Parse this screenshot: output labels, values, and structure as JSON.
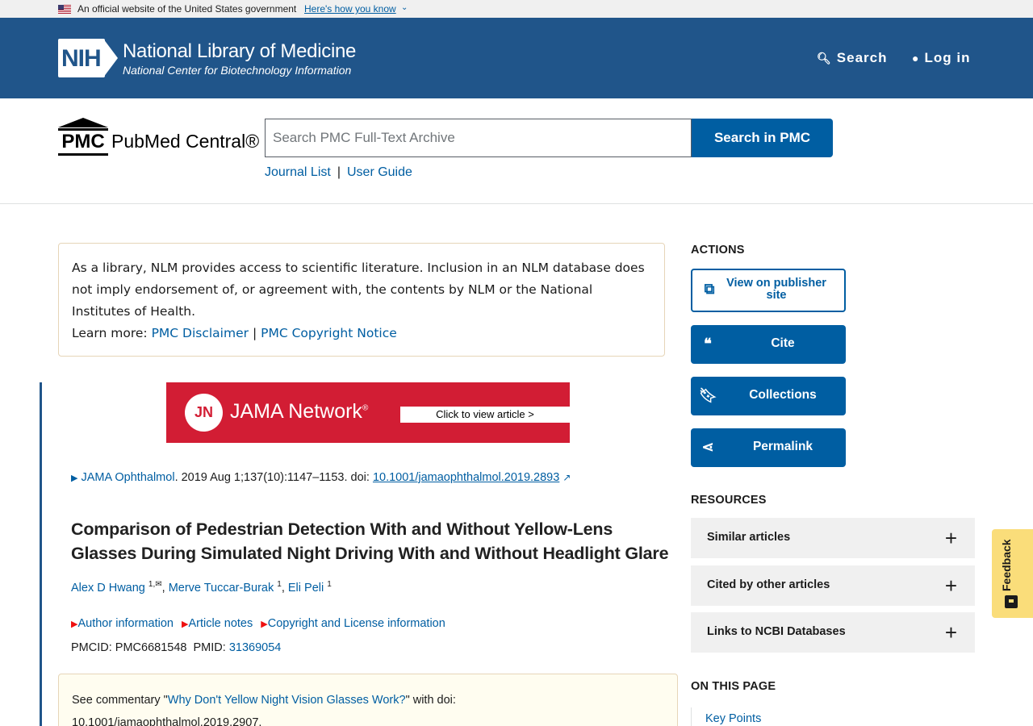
{
  "gov_banner": {
    "text": "An official website of the United States government",
    "link": "Here's how you know"
  },
  "header": {
    "logo_letters": "NIH",
    "title": "National Library of Medicine",
    "subtitle": "National Center for Biotechnology Information",
    "search_label": "Search",
    "login_label": "Log in",
    "bg_color": "#20558a"
  },
  "pmc": {
    "logo_box": "PMC",
    "logo_name": "PubMed Central®",
    "search_placeholder": "Search PMC Full-Text Archive",
    "search_button": "Search in PMC",
    "journal_list": "Journal List",
    "separator": "|",
    "user_guide": "User Guide"
  },
  "disclaimer": {
    "text": "As a library, NLM provides access to scientific literature. Inclusion in an NLM database does not imply endorsement of, or agreement with, the contents by NLM or the National Institutes of Health.",
    "learn_more": "Learn more:",
    "link1": "PMC Disclaimer",
    "sep": "|",
    "link2": "PMC Copyright Notice"
  },
  "ad": {
    "logo": "JN",
    "name": "JAMA Network",
    "name_mark": "®",
    "cta": "Click to view article >",
    "color": "#d21d34"
  },
  "article": {
    "journal": "JAMA Ophthalmol",
    "citation": ". 2019 Aug 1;137(10):1147–1153. doi: ",
    "doi": "10.1001/jamaophthalmol.2019.2893",
    "title": "Comparison of Pedestrian Detection With and Without Yellow-Lens Glasses During Simulated Night Driving With and Without Headlight Glare",
    "authors": [
      {
        "name": "Alex D Hwang",
        "sup": "1,✉"
      },
      {
        "name": "Merve Tuccar-Burak",
        "sup": "1"
      },
      {
        "name": "Eli Peli",
        "sup": "1"
      }
    ],
    "info_links": [
      "Author information",
      "Article notes",
      "Copyright and License information"
    ],
    "pmcid_label": "PMCID: PMC6681548",
    "pmid_label": "PMID:",
    "pmid": "31369054",
    "commentary_prefix": "See commentary \"",
    "commentary_link": "Why Don't Yellow Night Vision Glasses Work?",
    "commentary_suffix": "\" with doi:",
    "commentary_doi": "10.1001/jamaophthalmol.2019.2907."
  },
  "sidebar": {
    "actions_heading": "ACTIONS",
    "actions": [
      {
        "label": "View on publisher site",
        "icon": "external-link-icon"
      },
      {
        "label": "Cite",
        "icon": "quote-icon"
      },
      {
        "label": "Collections",
        "icon": "bookmark-icon"
      },
      {
        "label": "Permalink",
        "icon": "share-icon"
      }
    ],
    "resources_heading": "RESOURCES",
    "resources": [
      "Similar articles",
      "Cited by other articles",
      "Links to NCBI Databases"
    ],
    "on_this_page_heading": "ON THIS PAGE",
    "on_this_page": [
      "Key Points"
    ]
  },
  "feedback": {
    "label": "Feedback"
  }
}
